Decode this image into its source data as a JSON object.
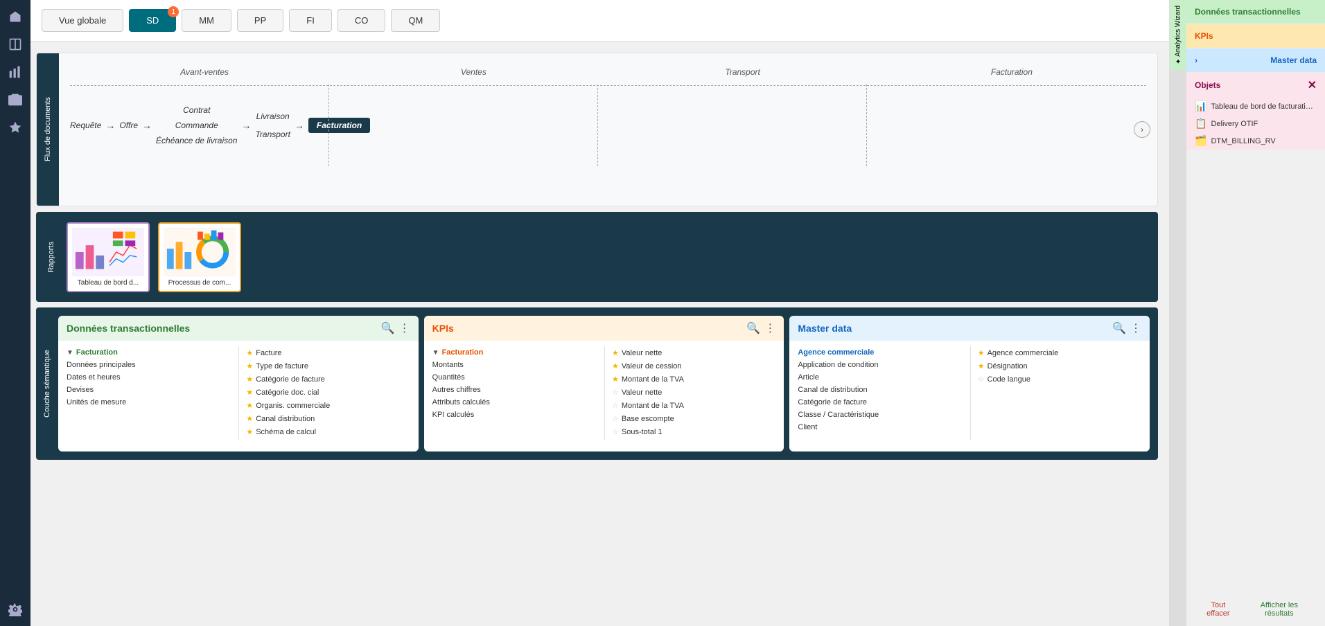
{
  "sidebar": {
    "icons": [
      {
        "name": "home-icon",
        "symbol": "⌂"
      },
      {
        "name": "book-icon",
        "symbol": "📖"
      },
      {
        "name": "chart-icon",
        "symbol": "📊"
      },
      {
        "name": "camera-icon",
        "symbol": "📷"
      },
      {
        "name": "star-icon",
        "symbol": "☆"
      },
      {
        "name": "user-icon",
        "symbol": "👤"
      }
    ]
  },
  "topnav": {
    "vue_globale": "Vue globale",
    "sd": "SD",
    "mm": "MM",
    "pp": "PP",
    "fi": "FI",
    "co": "CO",
    "qm": "QM",
    "notification_count": "1"
  },
  "process_flow": {
    "label": "Flux de documents",
    "columns": [
      "Avant-ventes",
      "Ventes",
      "Transport",
      "Facturation"
    ],
    "nodes": {
      "requete": "Requête",
      "offre": "Offre",
      "contrat": "Contrat",
      "commande": "Commande",
      "echeance": "Échéance de livraison",
      "livraison": "Livraison",
      "transport": "Transport",
      "facturation": "Facturation"
    }
  },
  "reports": {
    "label": "Rapports",
    "items": [
      {
        "title": "Tableau de bord d...",
        "id": "report-1"
      },
      {
        "title": "Processus de com...",
        "id": "report-2"
      }
    ]
  },
  "semantic": {
    "label": "Couche sémantique",
    "panels": {
      "transactional": {
        "title": "Données transactionnelles",
        "category": "Facturation",
        "category_items": [
          "Données principales",
          "Dates et heures",
          "Devises",
          "Unités de mesure"
        ],
        "starred_items": [
          "Facture",
          "Type de facture",
          "Catégorie de facture",
          "Catégorie doc. cial",
          "Organis. commerciale",
          "Canal distribution",
          "Schéma de calcul"
        ]
      },
      "kpis": {
        "title": "KPIs",
        "category": "Facturation",
        "category_items": [
          "Montants",
          "Quantités",
          "Autres chiffres",
          "Attributs calculés",
          "KPI calculés"
        ],
        "starred_items": [
          "Valeur nette",
          "Valeur de cession",
          "Montant de la TVA"
        ],
        "unstarred_items": [
          "Valeur nette",
          "Montant de la TVA",
          "Base escompte",
          "Sous-total 1"
        ]
      },
      "masterdata": {
        "title": "Master data",
        "category": "Agence commerciale",
        "category_items": [
          "Application de condition",
          "Article",
          "Canal de distribution",
          "Catégorie de facture",
          "Classe / Caractéristique",
          "Client"
        ],
        "starred_items": [
          "Agence commerciale",
          "Désignation",
          "Code langue"
        ]
      }
    }
  },
  "right_panel": {
    "sections": [
      {
        "id": "transactional",
        "label": "Données transactionnelles",
        "color": "green"
      },
      {
        "id": "kpis",
        "label": "KPIs",
        "color": "orange"
      },
      {
        "id": "masterdata",
        "label": "Master data",
        "color": "blue"
      }
    ],
    "analytics_tab": "Analytics Wizard",
    "objects_label": "Objets",
    "objects_items": [
      {
        "icon": "📊",
        "label": "Tableau de bord de facturation cl..."
      },
      {
        "icon": "📋",
        "label": "Delivery OTIF"
      },
      {
        "icon": "🗂️",
        "label": "DTM_BILLING_RV"
      }
    ],
    "footer": {
      "clear": "Tout effacer",
      "show": "Afficher les résultats"
    }
  },
  "collapse_btn": ">",
  "expand_btn": ">"
}
